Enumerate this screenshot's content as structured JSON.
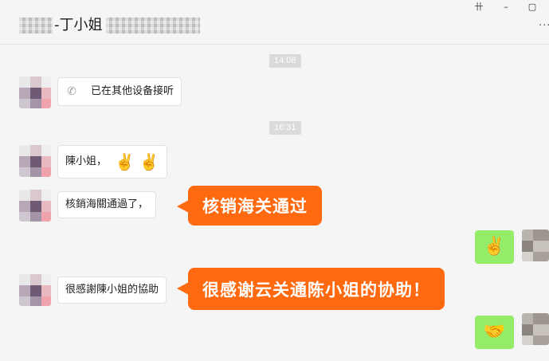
{
  "header": {
    "title": "-丁小姐",
    "pin_icon": "pin-icon",
    "pin_glyph": "卄",
    "minimize_glyph": "–",
    "maximize_glyph": "▢",
    "more_glyph": "···"
  },
  "timestamps": [
    "14:08",
    "16:31"
  ],
  "messages": [
    {
      "side": "left",
      "icon": "phone-icon",
      "icon_glyph": "✆",
      "text": "已在其他设备接听"
    },
    {
      "side": "left",
      "text": "陳小姐，",
      "emojis": [
        "✌️",
        "✌️"
      ]
    },
    {
      "side": "left",
      "text": "核銷海關通過了，"
    },
    {
      "side": "right",
      "emoji": "✌️"
    },
    {
      "side": "left",
      "text": "很感謝陳小姐的協助"
    },
    {
      "side": "right",
      "emoji": "🤝"
    }
  ],
  "callouts": [
    "核销海关通过",
    "很感谢云关通陈小姐的协助！"
  ],
  "colors": {
    "background": "#f5f5f5",
    "self_bubble": "#95ec69",
    "callout": "#ff6a10",
    "timestamp_badge": "#dadada"
  }
}
